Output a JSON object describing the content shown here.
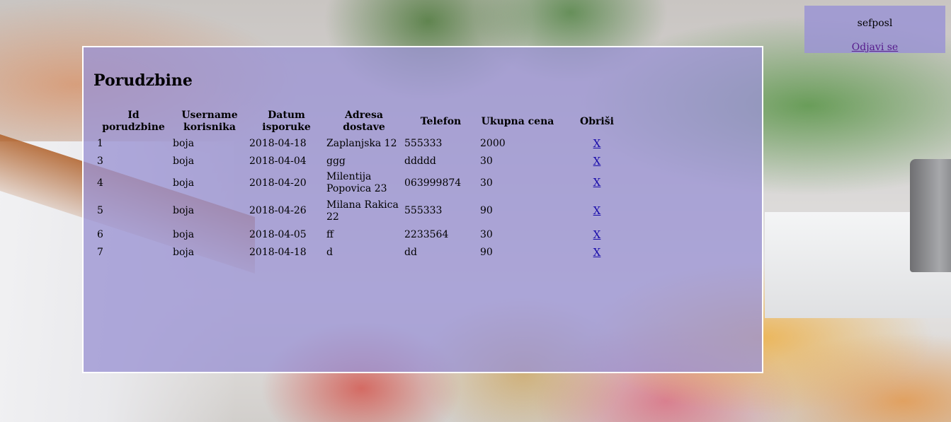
{
  "page": {
    "title": "Porudzbine"
  },
  "user": {
    "name": "sefposl",
    "logout_label": "Odjavi se"
  },
  "table": {
    "headers": {
      "id": "Id porudzbine",
      "username": "Username korisnika",
      "date": "Datum isporuke",
      "address": "Adresa dostave",
      "phone": "Telefon",
      "total": "Ukupna cena",
      "delete": "Obriši"
    },
    "rows": [
      {
        "id": "1",
        "username": "boja",
        "date": "2018-04-18",
        "address": "Zaplanjska 12",
        "phone": "555333",
        "total": "2000",
        "delete": "X"
      },
      {
        "id": "3",
        "username": "boja",
        "date": "2018-04-04",
        "address": "ggg",
        "phone": "ddddd",
        "total": "30",
        "delete": "X"
      },
      {
        "id": "4",
        "username": "boja",
        "date": "2018-04-20",
        "address": "Milentija Popovica 23",
        "phone": "063999874",
        "total": "30",
        "delete": "X"
      },
      {
        "id": "5",
        "username": "boja",
        "date": "2018-04-26",
        "address": "Milana Rakica 22",
        "phone": "555333",
        "total": "90",
        "delete": "X"
      },
      {
        "id": "6",
        "username": "boja",
        "date": "2018-04-05",
        "address": "ff",
        "phone": "2233564",
        "total": "30",
        "delete": "X"
      },
      {
        "id": "7",
        "username": "boja",
        "date": "2018-04-18",
        "address": "d",
        "phone": "dd",
        "total": "90",
        "delete": "X"
      }
    ]
  },
  "colors": {
    "panel_bg": "#9b94d4",
    "panel_border": "#ffffff",
    "link": "#1a0dab",
    "visited_link": "#551a8b"
  }
}
